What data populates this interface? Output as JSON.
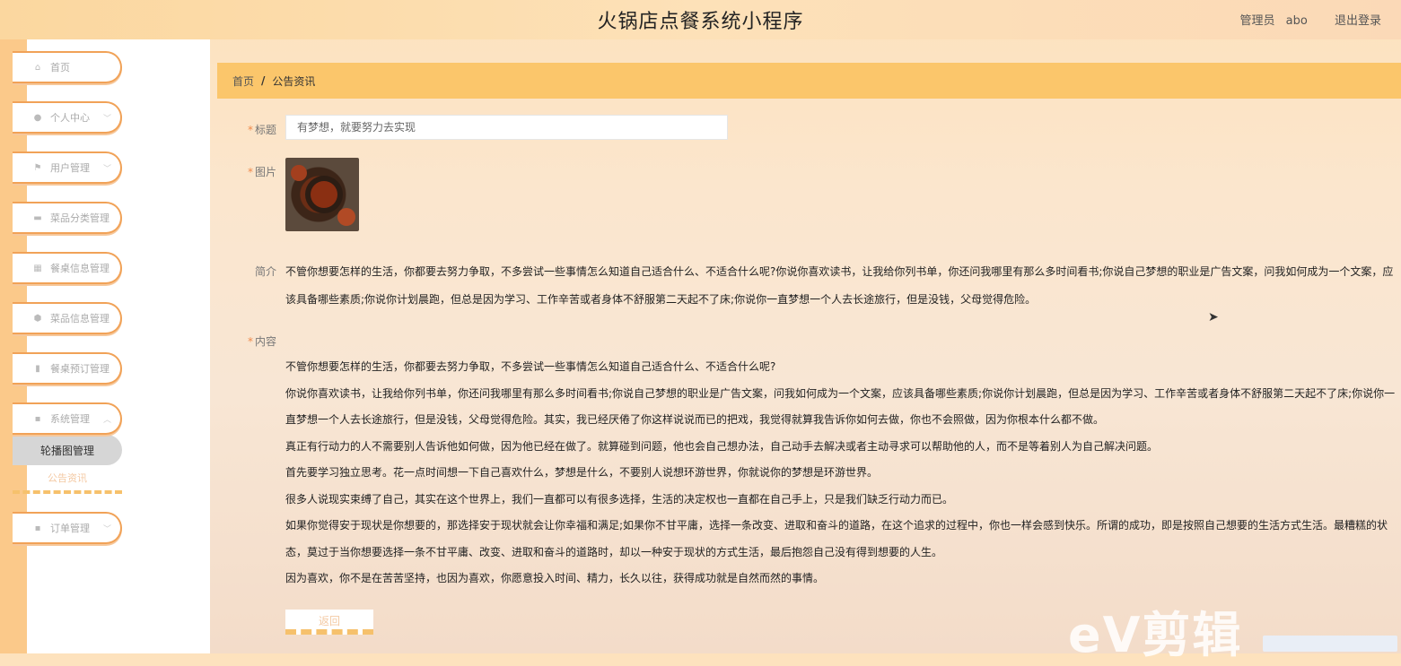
{
  "header": {
    "title": "火锅店点餐系统小程序",
    "user_role": "管理员",
    "username": "abo",
    "logout": "退出登录"
  },
  "sidebar": {
    "items": [
      {
        "label": "首页",
        "icon": "home-icon",
        "glyph": "⌂"
      },
      {
        "label": "个人中心",
        "icon": "user-icon",
        "glyph": "●"
      },
      {
        "label": "用户管理",
        "icon": "flag-icon",
        "glyph": "⚑"
      },
      {
        "label": "菜品分类管理",
        "icon": "chat-icon",
        "glyph": "▬"
      },
      {
        "label": "餐桌信息管理",
        "icon": "grid-icon",
        "glyph": "▦"
      },
      {
        "label": "菜品信息管理",
        "icon": "shield-icon",
        "glyph": "⬢"
      },
      {
        "label": "餐桌预订管理",
        "icon": "bar-chart-icon",
        "glyph": "▮"
      },
      {
        "label": "系统管理",
        "icon": "apps-icon",
        "glyph": "▪"
      },
      {
        "label": "订单管理",
        "icon": "apps-icon",
        "glyph": "▪"
      }
    ],
    "system_sub": [
      "轮播图管理",
      "公告资讯"
    ]
  },
  "breadcrumb": {
    "home": "首页",
    "current": "公告资讯"
  },
  "form": {
    "title_label": "标题",
    "title_value": "有梦想，就要努力去实现",
    "image_label": "图片",
    "intro_label": "简介",
    "intro_text": "不管你想要怎样的生活，你都要去努力争取，不多尝试一些事情怎么知道自己适合什么、不适合什么呢?你说你喜欢读书，让我给你列书单，你还问我哪里有那么多时间看书;你说自己梦想的职业是广告文案，问我如何成为一个文案，应该具备哪些素质;你说你计划晨跑，但总是因为学习、工作辛苦或者身体不舒服第二天起不了床;你说你一直梦想一个人去长途旅行，但是没钱，父母觉得危险。",
    "content_label": "内容",
    "content_paragraphs": [
      "不管你想要怎样的生活，你都要去努力争取，不多尝试一些事情怎么知道自己适合什么、不适合什么呢?",
      "你说你喜欢读书，让我给你列书单，你还问我哪里有那么多时间看书;你说自己梦想的职业是广告文案，问我如何成为一个文案，应该具备哪些素质;你说你计划晨跑，但总是因为学习、工作辛苦或者身体不舒服第二天起不了床;你说你一直梦想一个人去长途旅行，但是没钱，父母觉得危险。其实，我已经厌倦了你这样说说而已的把戏，我觉得就算我告诉你如何去做，你也不会照做，因为你根本什么都不做。",
      "真正有行动力的人不需要别人告诉他如何做，因为他已经在做了。就算碰到问题，他也会自己想办法，自己动手去解决或者主动寻求可以帮助他的人，而不是等着别人为自己解决问题。",
      "首先要学习独立思考。花一点时间想一下自己喜欢什么，梦想是什么，不要别人说想环游世界，你就说你的梦想是环游世界。",
      "很多人说现实束缚了自己，其实在这个世界上，我们一直都可以有很多选择，生活的决定权也一直都在自己手上，只是我们缺乏行动力而已。",
      "如果你觉得安于现状是你想要的，那选择安于现状就会让你幸福和满足;如果你不甘平庸，选择一条改变、进取和奋斗的道路，在这个追求的过程中，你也一样会感到快乐。所谓的成功，即是按照自己想要的生活方式生活。最糟糕的状态，莫过于当你想要选择一条不甘平庸、改变、进取和奋斗的道路时，却以一种安于现状的方式生活，最后抱怨自己没有得到想要的人生。",
      "因为喜欢，你不是在苦苦坚持，也因为喜欢，你愿意投入时间、精力，长久以往，获得成功就是自然而然的事情。"
    ],
    "back_label": "返回"
  },
  "watermark": "eV剪辑"
}
